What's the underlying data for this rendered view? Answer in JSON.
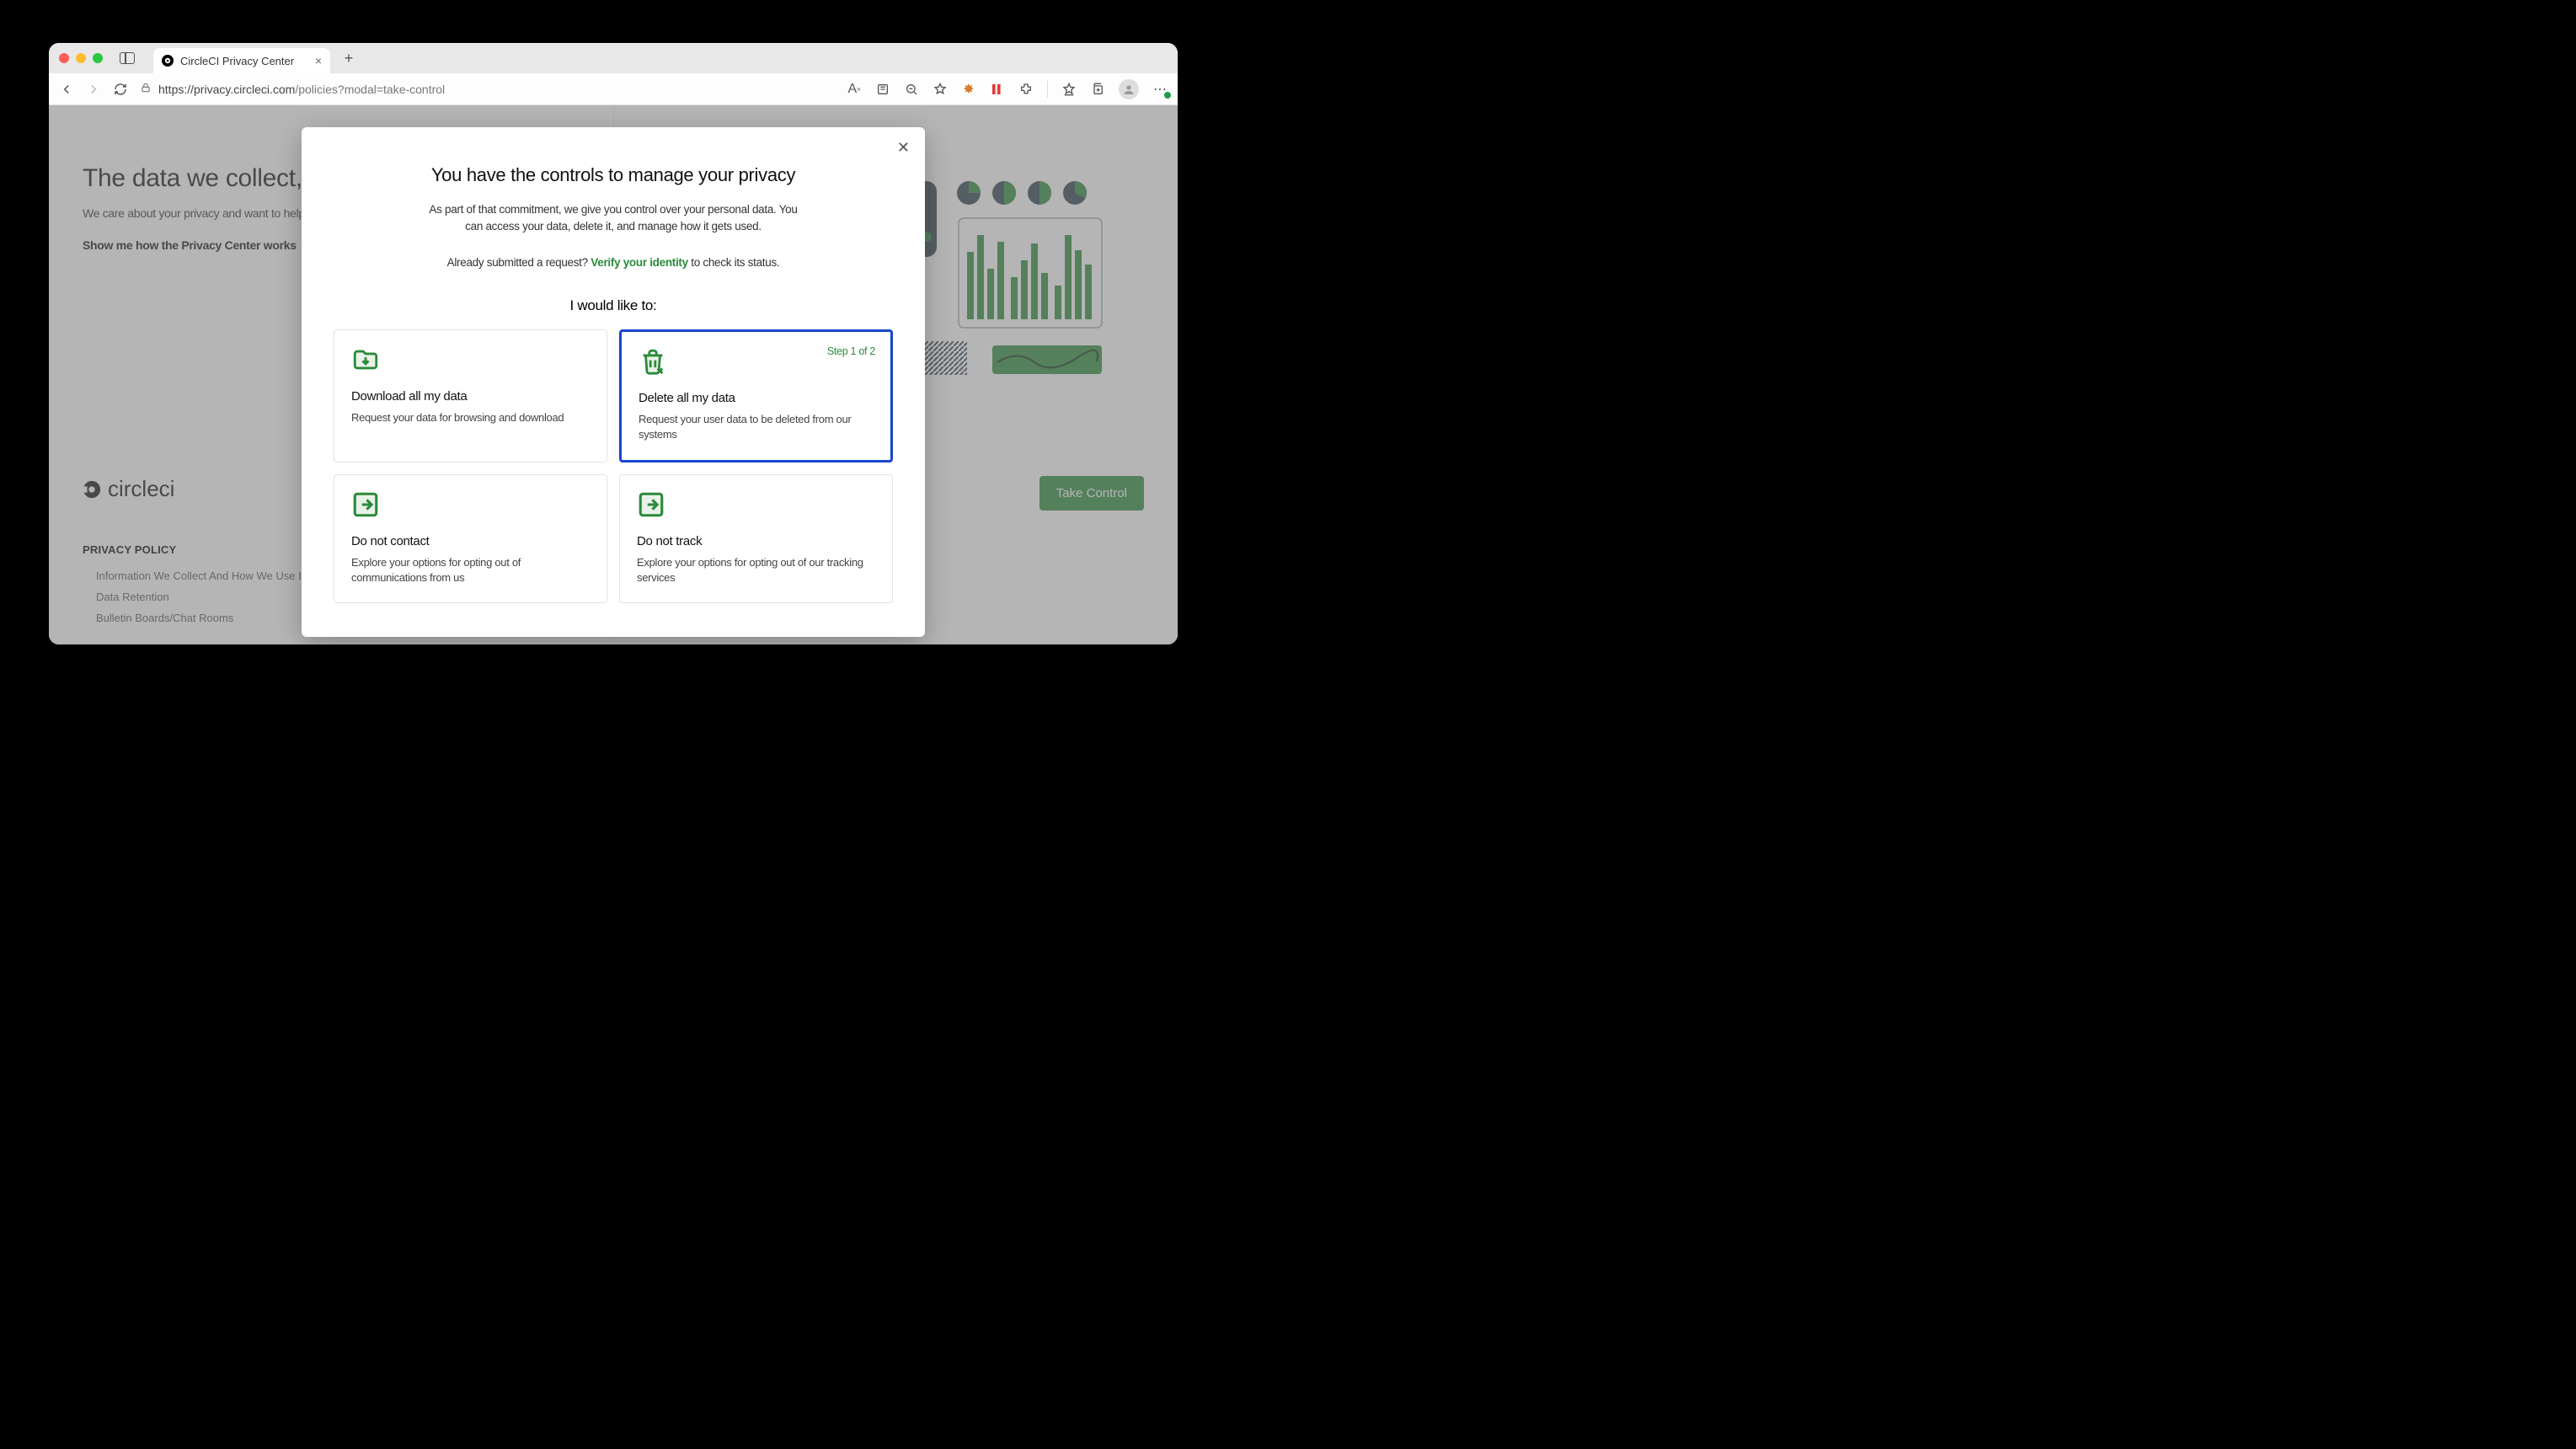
{
  "browser": {
    "tab_title": "CircleCI Privacy Center",
    "url_host": "https://privacy.circleci.com",
    "url_path": "/policies?modal=take-control"
  },
  "page": {
    "heading": "The data we collect, how it's u",
    "intro": "We care about your privacy and want to help you under",
    "show_me": "Show me how the Privacy Center works",
    "brand": "circleci",
    "policy_heading": "PRIVACY POLICY",
    "policy_items": [
      "Information We Collect And How We Use It",
      "Data Retention",
      "Bulletin Boards/Chat Rooms"
    ],
    "take_control": "Take Control"
  },
  "modal": {
    "title": "You have the controls to manage your privacy",
    "subtitle": "As part of that commitment, we give you control over your personal data. You can access your data, delete it, and manage how it gets used.",
    "status_prefix": "Already submitted a request? ",
    "status_link": "Verify your identity",
    "status_suffix": " to check its status.",
    "section": "I would like to:",
    "cards": [
      {
        "title": "Download all my data",
        "desc": "Request your data for browsing and download"
      },
      {
        "title": "Delete all my data",
        "desc": "Request your user data to be deleted from our systems",
        "step": "Step 1 of 2",
        "selected": true
      },
      {
        "title": "Do not contact",
        "desc": "Explore your options for opting out of communications from us"
      },
      {
        "title": "Do not track",
        "desc": "Explore your options for opting out of our tracking services"
      }
    ]
  }
}
